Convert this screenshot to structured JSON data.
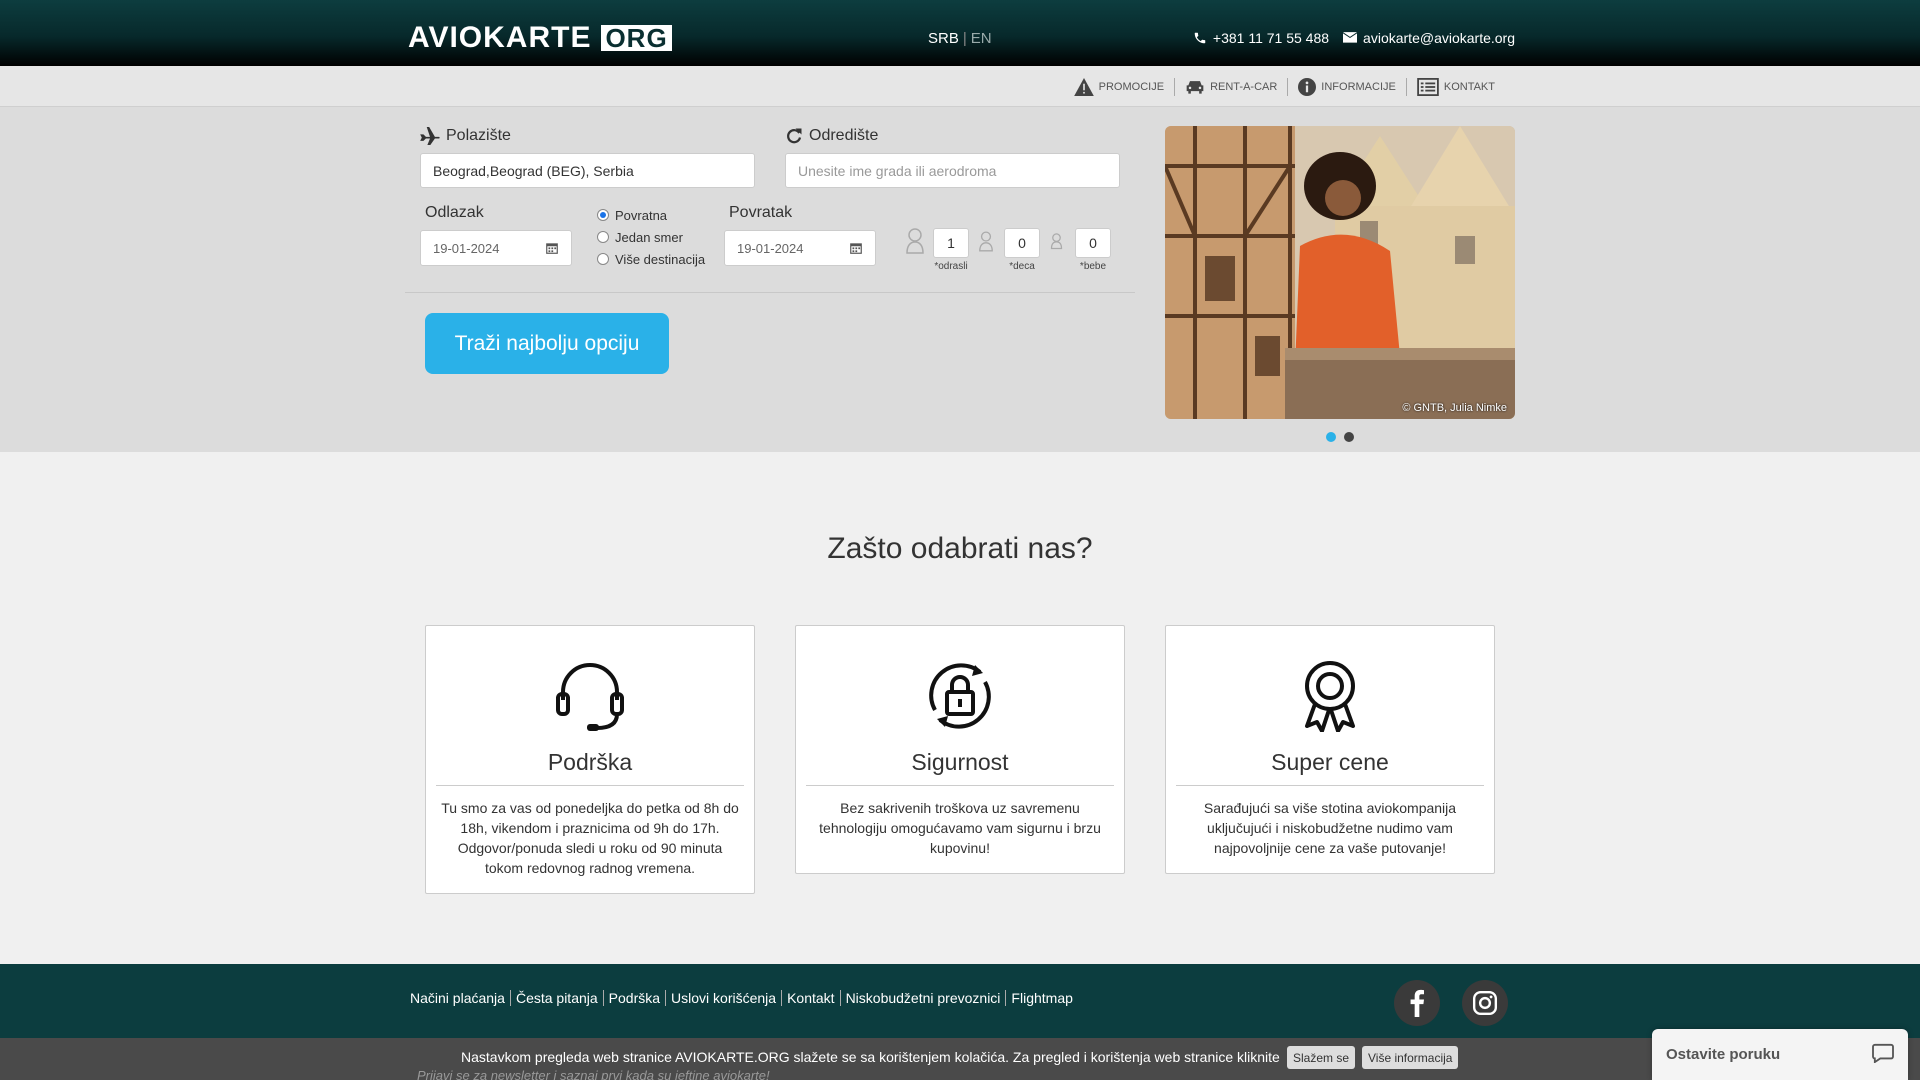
{
  "header": {
    "logo_text": "AVIOKARTE",
    "logo_box": "ORG",
    "lang_active": "SRB",
    "lang_separator": "|",
    "lang_other": "EN",
    "phone": "+381 11 71 55 488",
    "email": "aviokarte@aviokarte.org"
  },
  "subnav": {
    "items": [
      "PROMOCIJE",
      "RENT-A-CAR",
      "INFORMACIJE",
      "KONTAKT"
    ]
  },
  "search": {
    "from_label": "Polazište",
    "from_value": "Beograd,Beograd (BEG), Serbia",
    "to_label": "Odredište",
    "to_placeholder": "Unesite ime grada ili aerodroma",
    "depart_label": "Odlazak",
    "depart_value": "19-01-2024",
    "return_label": "Povratak",
    "return_value": "19-01-2024",
    "trip_types": [
      "Povratna",
      "Jedan smer",
      "Više destinacija"
    ],
    "trip_selected": "Povratna",
    "adults": "1",
    "adults_label": "*odrasli",
    "children": "0",
    "children_label": "*deca",
    "infants": "0",
    "infants_label": "*bebe",
    "submit_label": "Traži najbolju opciju"
  },
  "slider": {
    "credit": "© GNTB, Julia Nimke",
    "active_index": 0,
    "count": 2
  },
  "why": {
    "title": "Zašto odabrati nas?",
    "cards": [
      {
        "icon": "headset-icon",
        "title": "Podrška",
        "text": "Tu smo za vas od ponedeljka do petka od 8h do 18h, vikendom i praznicima od 9h do 17h. Odgovor/ponuda sledi u roku od 90 minuta tokom redovnog radnog vremena."
      },
      {
        "icon": "lock-icon",
        "title": "Sigurnost",
        "text": "Bez sakrivenih troškova uz savremenu tehnologiju omogućavamo vam sigurnu i brzu kupovinu!"
      },
      {
        "icon": "award-icon",
        "title": "Super cene",
        "text": "Sarađujući sa više stotina aviokompanija uključujući i niskobudžetne nudimo vam najpovoljnije cene za vaše putovanje!"
      }
    ]
  },
  "footer": {
    "links": [
      "Načini plaćanja",
      "Česta pitanja",
      "Podrška",
      "Uslovi korišćenja",
      "Kontakt",
      "Niskobudžetni prevoznici",
      "Flightmap"
    ]
  },
  "cookie": {
    "text": "Nastavkom pregleda web stranice AVIOKARTE.ORG slažete se sa korištenjem kolačića. Za pregled i korištenja web stranice kliknite",
    "accept_label": "Slažem se",
    "more_label": "Više informacija"
  },
  "newsletter": {
    "text": "Prijavi se za newsletter i saznaj prvi kada su jeftine aviokarte!"
  },
  "chat": {
    "label": "Ostavite poruku"
  },
  "colors": {
    "header_bg": "#0c3d3f",
    "accent": "#2ab1e8"
  }
}
